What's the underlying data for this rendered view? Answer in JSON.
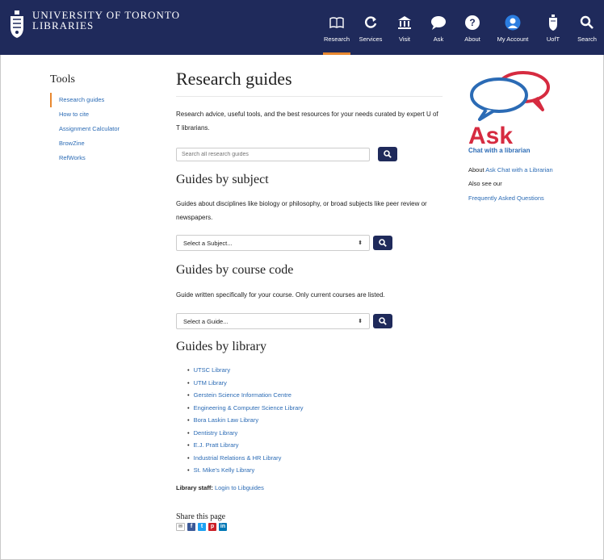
{
  "header": {
    "logo_line1": "UNIVERSITY OF TORONTO",
    "logo_line2": "LIBRARIES",
    "nav": [
      {
        "label": "Research",
        "icon": "book-icon",
        "active": true
      },
      {
        "label": "Services",
        "icon": "refresh-icon",
        "active": false
      },
      {
        "label": "Visit",
        "icon": "building-icon",
        "active": false
      },
      {
        "label": "Ask",
        "icon": "chat-bubble-icon",
        "active": false
      },
      {
        "label": "About",
        "icon": "question-circle-icon",
        "active": false
      },
      {
        "label": "My Account",
        "icon": "user-icon",
        "active": false
      },
      {
        "label": "UofT",
        "icon": "crest-icon",
        "active": false
      },
      {
        "label": "Search",
        "icon": "search-icon",
        "active": false
      }
    ],
    "accent": "#e8882f",
    "bar_color": "#1f2a5b"
  },
  "sidebar": {
    "title": "Tools",
    "items": [
      {
        "label": "Research guides"
      },
      {
        "label": "How to cite"
      },
      {
        "label": "Assignment Calculator"
      },
      {
        "label": "BrowZine"
      },
      {
        "label": "RefWorks"
      }
    ]
  },
  "main": {
    "title": "Research guides",
    "intro": "Research advice, useful tools, and the best resources for your needs curated by expert U of T librarians.",
    "search_placeholder": "Search all research guides",
    "subject": {
      "heading": "Guides by subject",
      "text": "Guides about disciplines like biology or philosophy, or broad subjects like peer review or newspapers.",
      "select_value": "Select a Subject..."
    },
    "course": {
      "heading": "Guides by course code",
      "text": "Guide written specifically for your course.  Only current courses are listed.",
      "select_value": "Select a Guide..."
    },
    "library": {
      "heading": "Guides by library",
      "items": [
        "UTSC Library",
        "UTM Library",
        "Gerstein Science Information Centre",
        "Engineering & Computer Science Library",
        "Bora Laskin Law Library",
        "Dentistry Library",
        "E.J. Pratt Library",
        "Industrial Relations & HR Library",
        "St. Mike's Kelly Library"
      ]
    },
    "staff_label": "Library staff:",
    "staff_link": "Login to Libguides",
    "share_title": "Share this page"
  },
  "right": {
    "ask_word": "Ask",
    "ask_sub": "Chat with a librarian",
    "about_label": "About",
    "about_link": "Ask Chat with a Librarian",
    "also_see": "Also see our",
    "faq_link": "Frequently Asked Questions"
  }
}
